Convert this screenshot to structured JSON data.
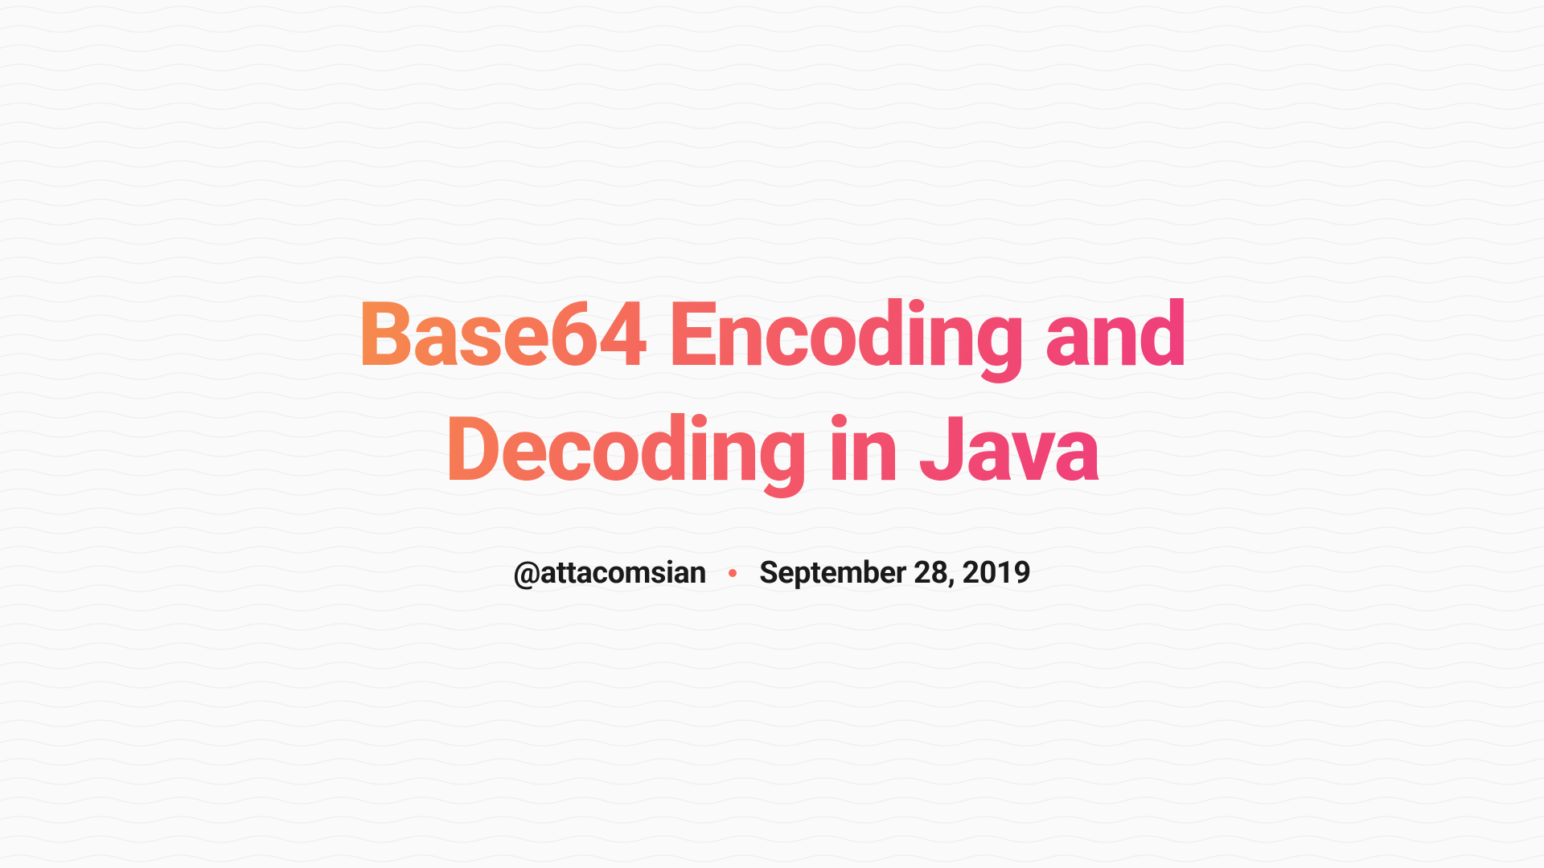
{
  "title": "Base64 Encoding and Decoding in Java",
  "meta": {
    "author": "@attacomsian",
    "date": "September 28, 2019"
  },
  "colors": {
    "gradient_start": "#f79548",
    "gradient_end": "#ed3883",
    "separator": "#f56a5c",
    "text": "#1a1a1a",
    "background": "#fafafa"
  }
}
